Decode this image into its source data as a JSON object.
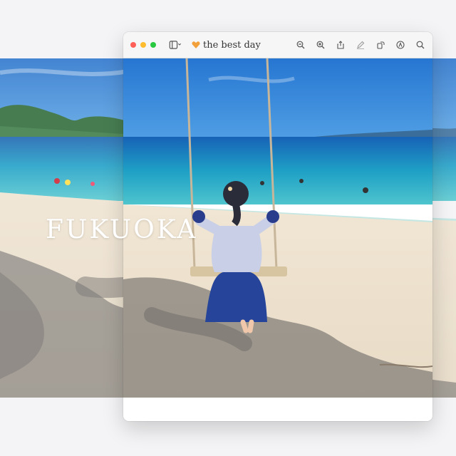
{
  "window": {
    "title": "the best day",
    "toolbar_icons": [
      "sidebar-toggle-icon",
      "document-heart-icon",
      "zoom-out-icon",
      "zoom-in-icon",
      "share-icon",
      "markup-pen-icon",
      "rotate-icon",
      "markup-toolbar-icon",
      "search-icon"
    ]
  },
  "photo": {
    "caption": "FUKUOKA"
  },
  "colors": {
    "sky": "#2b7fd3",
    "sea": "#1fa7c4",
    "sand": "#eadfcd",
    "shadow": "#6d6a6a",
    "close": "#fe5f57",
    "minimize": "#febc2e",
    "maximize": "#28c840"
  }
}
